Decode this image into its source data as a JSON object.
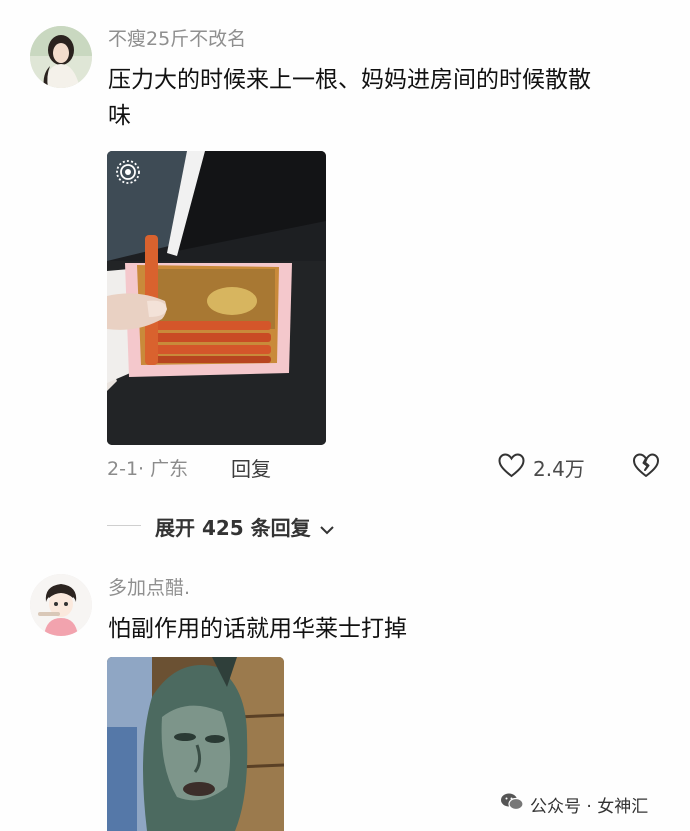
{
  "comments": [
    {
      "username": "不瘦25斤不改名",
      "text_line1": "压力大的时候来上一根、妈妈进房间的时候散散",
      "text_line2": "味",
      "meta": "2-1· 广东",
      "reply_label": "回复",
      "like_count": "2.4万",
      "icons": [
        "heart-outline-icon",
        "broken-heart-icon",
        "live-photo-icon"
      ]
    },
    {
      "username": "多加点醋.",
      "text": "怕副作用的话就用华莱士打掉"
    }
  ],
  "expand": {
    "label": "展开 425 条回复",
    "icon": "chevron-down-icon"
  },
  "watermark": {
    "text": "公众号 · 女神汇",
    "icon": "wechat-icon"
  },
  "colors": {
    "username": "#8f8f8f",
    "comment": "#111111",
    "meta": "#8b8b8b",
    "background": "#fefefe"
  }
}
